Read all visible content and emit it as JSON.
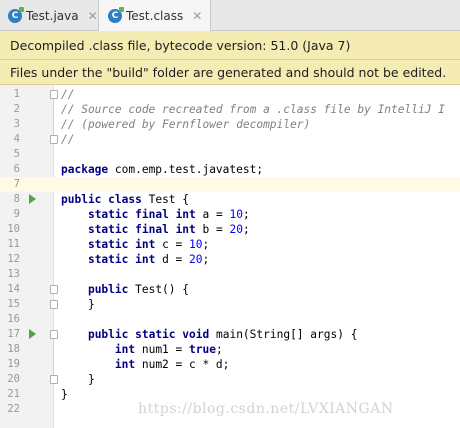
{
  "tabs": [
    {
      "label": "Test.java",
      "icon": "class-file-icon"
    },
    {
      "label": "Test.class",
      "icon": "class-file-icon"
    }
  ],
  "banners": {
    "decompiled": "Decompiled .class file, bytecode version: 51.0 (Java 7)",
    "build_warning": "Files under the \"build\" folder are generated and should not be edited."
  },
  "editor": {
    "lines": [
      {
        "n": "1",
        "code": "//"
      },
      {
        "n": "2",
        "code": "// Source code recreated from a .class file by IntelliJ I"
      },
      {
        "n": "3",
        "code": "// (powered by Fernflower decompiler)"
      },
      {
        "n": "4",
        "code": "//"
      },
      {
        "n": "5",
        "code": ""
      },
      {
        "n": "6",
        "code": "package com.emp.test.javatest;"
      },
      {
        "n": "7",
        "code": ""
      },
      {
        "n": "8",
        "code": "public class Test {"
      },
      {
        "n": "9",
        "code": "    static final int a = 10;"
      },
      {
        "n": "10",
        "code": "    static final int b = 20;"
      },
      {
        "n": "11",
        "code": "    static int c = 10;"
      },
      {
        "n": "12",
        "code": "    static int d = 20;"
      },
      {
        "n": "13",
        "code": ""
      },
      {
        "n": "14",
        "code": "    public Test() {"
      },
      {
        "n": "15",
        "code": "    }"
      },
      {
        "n": "16",
        "code": ""
      },
      {
        "n": "17",
        "code": "    public static void main(String[] args) {"
      },
      {
        "n": "18",
        "code": "        int num1 = true;"
      },
      {
        "n": "19",
        "code": "        int num2 = c * d;"
      },
      {
        "n": "20",
        "code": "    }"
      },
      {
        "n": "21",
        "code": "}"
      },
      {
        "n": "22",
        "code": ""
      }
    ]
  },
  "watermark": "https://blog.csdn.net/LVXIANGAN",
  "colors": {
    "keyword": "#000080",
    "comment": "#808080",
    "number": "#0000ff",
    "banner": "#f4ecb3",
    "run_arrow": "#4fa34a"
  }
}
